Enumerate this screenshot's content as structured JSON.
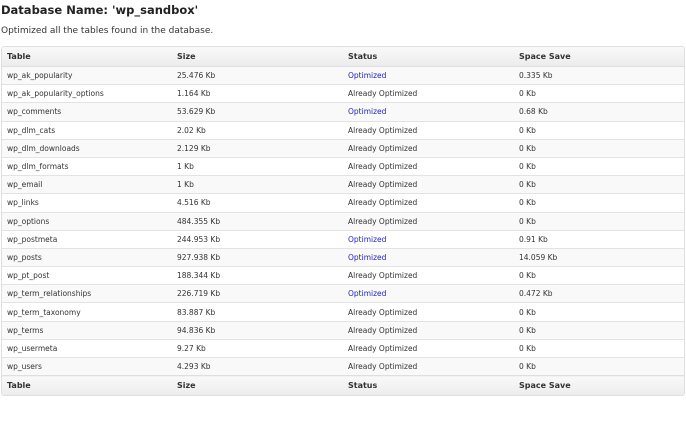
{
  "header": {
    "title": "Database Name: 'wp_sandbox'",
    "message": "Optimized all the tables found in the database."
  },
  "table": {
    "columns": [
      "Table",
      "Size",
      "Status",
      "Space Save"
    ],
    "rows": [
      {
        "table": "wp_ak_popularity",
        "size": "25.476 Kb",
        "status": "Optimized",
        "space_save": "0.335 Kb"
      },
      {
        "table": "wp_ak_popularity_options",
        "size": "1.164 Kb",
        "status": "Already Optimized",
        "space_save": "0 Kb"
      },
      {
        "table": "wp_comments",
        "size": "53.629 Kb",
        "status": "Optimized",
        "space_save": "0.68 Kb"
      },
      {
        "table": "wp_dlm_cats",
        "size": "2.02 Kb",
        "status": "Already Optimized",
        "space_save": "0 Kb"
      },
      {
        "table": "wp_dlm_downloads",
        "size": "2.129 Kb",
        "status": "Already Optimized",
        "space_save": "0 Kb"
      },
      {
        "table": "wp_dlm_formats",
        "size": "1 Kb",
        "status": "Already Optimized",
        "space_save": "0 Kb"
      },
      {
        "table": "wp_email",
        "size": "1 Kb",
        "status": "Already Optimized",
        "space_save": "0 Kb"
      },
      {
        "table": "wp_links",
        "size": "4.516 Kb",
        "status": "Already Optimized",
        "space_save": "0 Kb"
      },
      {
        "table": "wp_options",
        "size": "484.355 Kb",
        "status": "Already Optimized",
        "space_save": "0 Kb"
      },
      {
        "table": "wp_postmeta",
        "size": "244.953 Kb",
        "status": "Optimized",
        "space_save": "0.91 Kb"
      },
      {
        "table": "wp_posts",
        "size": "927.938 Kb",
        "status": "Optimized",
        "space_save": "14.059 Kb"
      },
      {
        "table": "wp_pt_post",
        "size": "188.344 Kb",
        "status": "Already Optimized",
        "space_save": "0 Kb"
      },
      {
        "table": "wp_term_relationships",
        "size": "226.719 Kb",
        "status": "Optimized",
        "space_save": "0.472 Kb"
      },
      {
        "table": "wp_term_taxonomy",
        "size": "83.887 Kb",
        "status": "Already Optimized",
        "space_save": "0 Kb"
      },
      {
        "table": "wp_terms",
        "size": "94.836 Kb",
        "status": "Already Optimized",
        "space_save": "0 Kb"
      },
      {
        "table": "wp_usermeta",
        "size": "9.27 Kb",
        "status": "Already Optimized",
        "space_save": "0 Kb"
      },
      {
        "table": "wp_users",
        "size": "4.293 Kb",
        "status": "Already Optimized",
        "space_save": "0 Kb"
      }
    ]
  },
  "colors": {
    "optimized_text": "#2124c9",
    "text": "#333333",
    "header_background": "#ececec",
    "border": "#dfdfdf"
  }
}
